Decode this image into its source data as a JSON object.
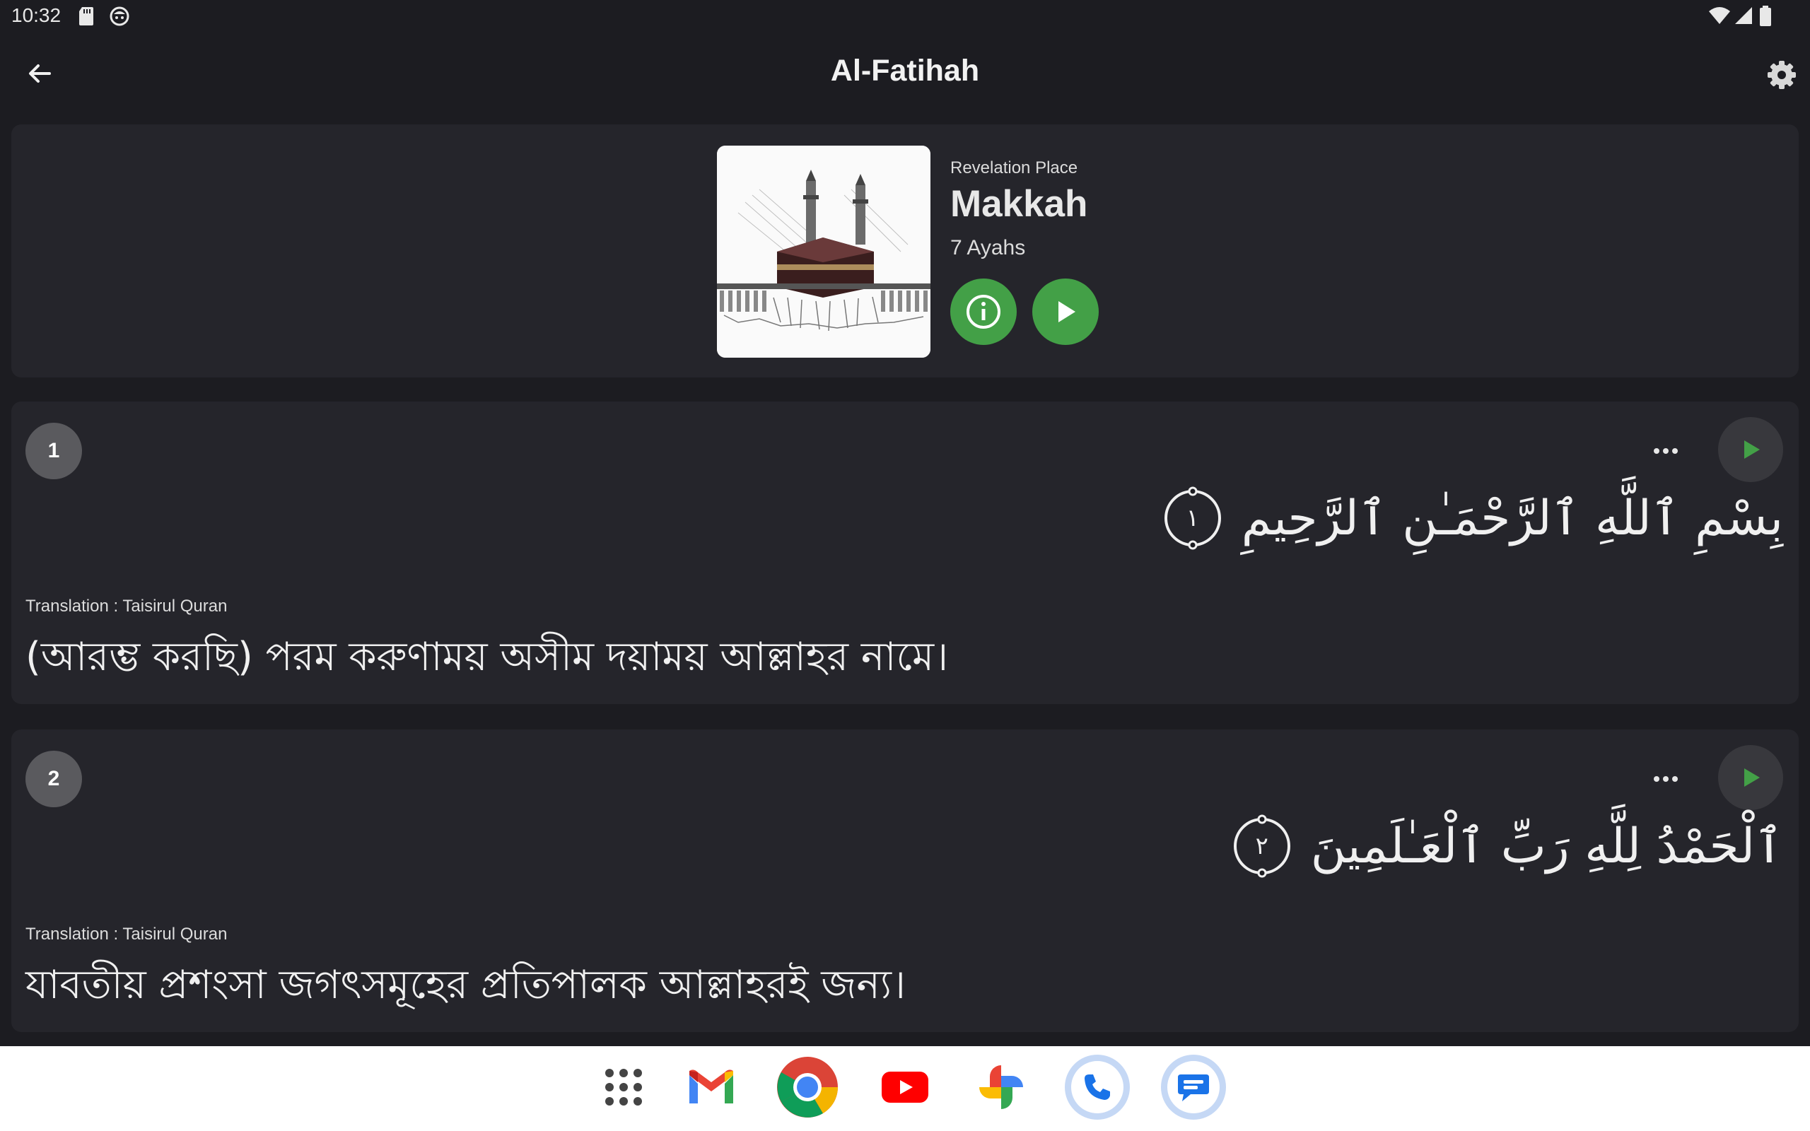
{
  "status_bar": {
    "time": "10:32"
  },
  "app_bar": {
    "title": "Al-Fatihah"
  },
  "surah_info": {
    "revelation_label": "Revelation Place",
    "revelation_place": "Makkah",
    "ayah_count": "7 Ayahs"
  },
  "verses": [
    {
      "number": "1",
      "arabic": "بِسْمِ ٱللَّهِ ٱلرَّحْمَـٰنِ ٱلرَّحِيمِ",
      "ayah_marker": "١",
      "translation_label": "Translation : Taisirul Quran",
      "translation": "(আরম্ভ করছি) পরম করুণাময় অসীম দয়াময় আল্লাহর নামে।"
    },
    {
      "number": "2",
      "arabic": "ٱلْحَمْدُ لِلَّهِ رَبِّ ٱلْعَـٰلَمِينَ",
      "ayah_marker": "٢",
      "translation_label": "Translation : Taisirul Quran",
      "translation": "যাবতীয় প্রশংসা জগৎসমূহের প্রতিপালক আল্লাহরই জন্য।"
    }
  ],
  "dock": [
    "apps-grid-icon",
    "gmail-icon",
    "chrome-icon",
    "youtube-icon",
    "photos-icon",
    "phone-icon",
    "messages-icon"
  ],
  "colors": {
    "background": "#1c1c21",
    "card": "#25252b",
    "accent_green": "#43a047",
    "badge": "#5a5a5e"
  }
}
